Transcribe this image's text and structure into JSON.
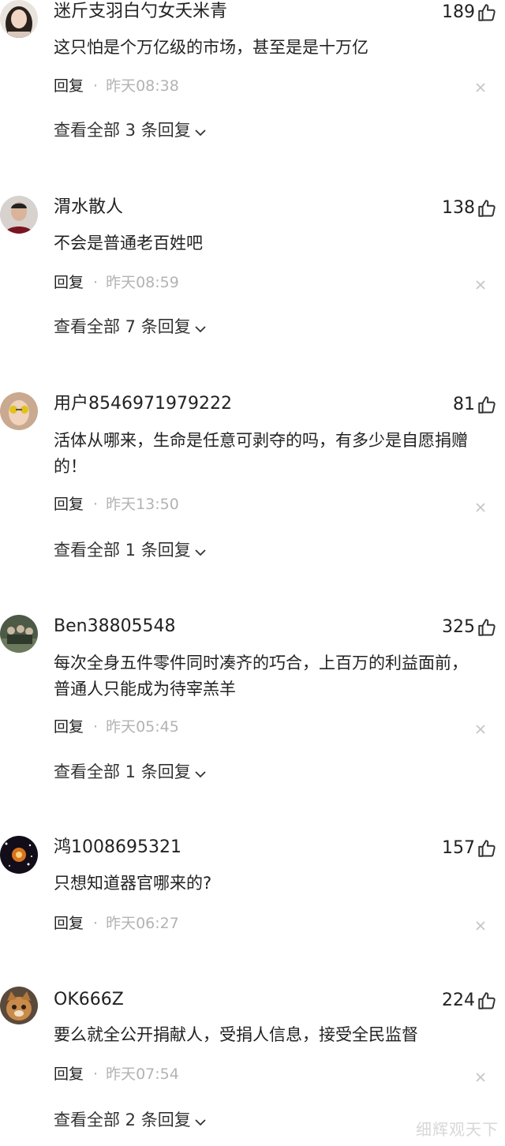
{
  "comments": [
    {
      "username": "迷斤支羽白勺女夭米青",
      "likes": "189",
      "text": "这只怕是个万亿级的市场，甚至是是十万亿",
      "reply_label": "回复",
      "separator": "·",
      "time": "昨天08:38",
      "view_replies": "查看全部 3 条回复",
      "avatar": "woman-portrait"
    },
    {
      "username": "渭水散人",
      "likes": "138",
      "text": "不会是普通老百姓吧",
      "reply_label": "回复",
      "separator": "·",
      "time": "昨天08:59",
      "view_replies": "查看全部 7 条回复",
      "avatar": "man-portrait"
    },
    {
      "username": "用户8546971979222",
      "likes": "81",
      "text": "活体从哪来，生命是任意可剥夺的吗，有多少是自愿捐赠的！",
      "reply_label": "回复",
      "separator": "·",
      "time": "昨天13:50",
      "view_replies": "查看全部 1 条回复",
      "avatar": "sunglasses-portrait"
    },
    {
      "username": "Ben38805548",
      "likes": "325",
      "text": "每次全身五件零件同时凑齐的巧合，上百万的利益面前，普通人只能成为待宰羔羊",
      "reply_label": "回复",
      "separator": "·",
      "time": "昨天05:45",
      "view_replies": "查看全部 1 条回复",
      "avatar": "group-photo"
    },
    {
      "username": "鸿1008695321",
      "likes": "157",
      "text": "只想知道器官哪来的?",
      "reply_label": "回复",
      "separator": "·",
      "time": "昨天06:27",
      "view_replies": "",
      "avatar": "galaxy"
    },
    {
      "username": "OK666Z",
      "likes": "224",
      "text": "要么就全公开捐献人，受捐人信息，接受全民监督",
      "reply_label": "回复",
      "separator": "·",
      "time": "昨天07:54",
      "view_replies": "查看全部 2 条回复",
      "avatar": "cat-photo"
    }
  ],
  "watermark": "细辉观天下",
  "colors": {
    "text": "#222222",
    "muted": "#b3b3b3",
    "icon": "#333333"
  }
}
